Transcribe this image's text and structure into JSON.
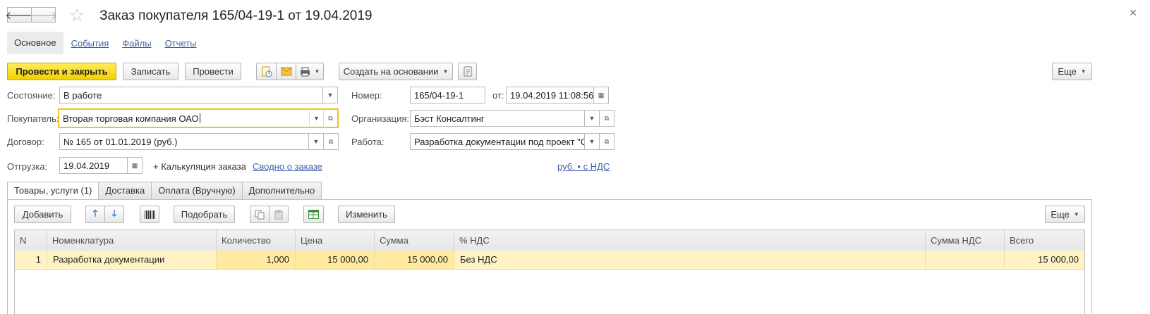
{
  "header": {
    "title": "Заказ покупателя 165/04-19-1 от 19.04.2019",
    "back_icon": "arrow-left-icon",
    "forward_icon": "arrow-right-icon",
    "star_icon": "star-icon",
    "close_icon": "close-icon"
  },
  "sections": {
    "main": "Основное",
    "events": "События",
    "files": "Файлы",
    "reports": "Отчеты"
  },
  "toolbar": {
    "post_close": "Провести и закрыть",
    "save": "Записать",
    "post": "Провести",
    "create_based": "Создать на основании",
    "more": "Еще"
  },
  "form": {
    "state_label": "Состояние:",
    "state_value": "В работе",
    "number_label": "Номер:",
    "number_value": "165/04-19-1",
    "date_label": "от:",
    "date_value": "19.04.2019 11:08:56",
    "buyer_label": "Покупатель:",
    "buyer_value": "Вторая торговая компания ОАО",
    "org_label": "Организация:",
    "org_value": "Бэст Консалтинг",
    "contract_label": "Договор:",
    "contract_value": "№ 165 от 01.01.2019 (руб.)",
    "work_label": "Работа:",
    "work_value": "Разработка документации под проект \"Се",
    "shipment_label": "Отгрузка:",
    "shipment_value": "19.04.2019",
    "calc_link": "+ Калькуляция заказа",
    "summary_link": "Сводно о заказе",
    "currency_link": "руб. • с НДС"
  },
  "tabs": [
    "Товары, услуги (1)",
    "Доставка",
    "Оплата (Вручную)",
    "Дополнительно"
  ],
  "table_toolbar": {
    "add": "Добавить",
    "pick": "Подобрать",
    "change": "Изменить",
    "more": "Еще"
  },
  "table": {
    "columns": [
      "N",
      "Номенклатура",
      "Количество",
      "Цена",
      "Сумма",
      "% НДС",
      "Сумма НДС",
      "Всего"
    ],
    "rows": [
      [
        "1",
        "Разработка документации",
        "1,000",
        "15 000,00",
        "15 000,00",
        "Без НДС",
        "",
        "15 000,00"
      ]
    ]
  },
  "colors": {
    "accent_yellow": "#f2d000",
    "link_blue": "#3c5fa8",
    "row_selected": "#fff3c4",
    "focus_border": "#f0c419"
  }
}
